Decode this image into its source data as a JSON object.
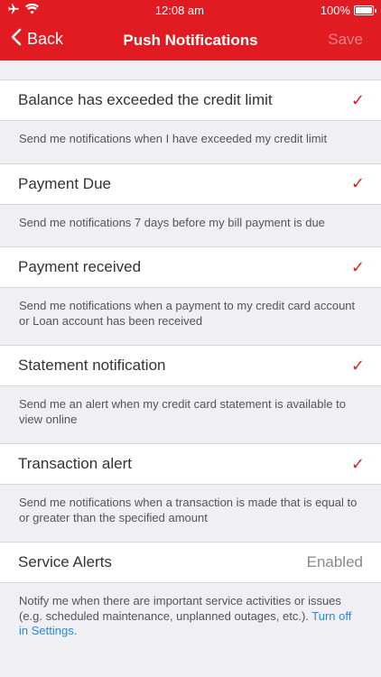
{
  "status_bar": {
    "time": "12:08 am",
    "battery": "100%"
  },
  "nav": {
    "back_label": "Back",
    "title": "Push Notifications",
    "save_label": "Save"
  },
  "items": [
    {
      "label": "Balance has exceeded the credit limit",
      "checked": true,
      "description": "Send me notifications when I have exceeded my credit limit"
    },
    {
      "label": "Payment Due",
      "checked": true,
      "description": "Send me notifications 7 days before my bill payment is due"
    },
    {
      "label": "Payment received",
      "checked": true,
      "description": "Send me notifications when a payment to my credit card account or Loan account has been received"
    },
    {
      "label": "Statement notification",
      "checked": true,
      "description": "Send me an alert when my credit card statement is available to view online"
    },
    {
      "label": "Transaction alert",
      "checked": true,
      "description": "Send me notifications when a transaction is made that is equal to or greater than the specified amount"
    }
  ],
  "service": {
    "label": "Service Alerts",
    "value": "Enabled",
    "description": "Notify me when there are important service activities or issues (e.g. scheduled maintenance, unplanned outages, etc.).",
    "link": "Turn off in Settings."
  },
  "colors": {
    "brand": "#e01b22",
    "check": "#d9232a",
    "link": "#2a8ad6"
  },
  "icons": {
    "check": "✓"
  }
}
